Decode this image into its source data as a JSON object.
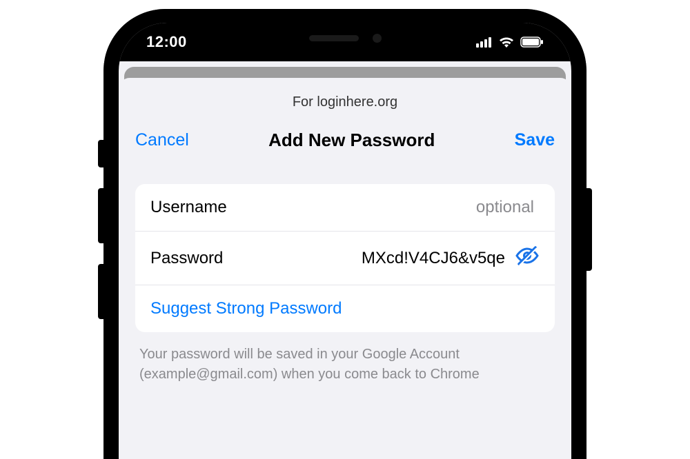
{
  "status_bar": {
    "time": "12:00"
  },
  "sheet": {
    "subtitle": "For loginhere.org",
    "cancel_label": "Cancel",
    "title": "Add New Password",
    "save_label": "Save"
  },
  "form": {
    "username_label": "Username",
    "username_value": "",
    "username_placeholder": "optional",
    "password_label": "Password",
    "password_value": "MXcd!V4CJ6&v5qe",
    "suggest_label": "Suggest Strong Password"
  },
  "footer": {
    "text": "Your password will be saved in your Google Account (example@gmail.com) when you come back to Chrome"
  },
  "colors": {
    "accent": "#007aff",
    "sheet_bg": "#f2f2f6",
    "secondary_text": "#8a8a8e"
  }
}
